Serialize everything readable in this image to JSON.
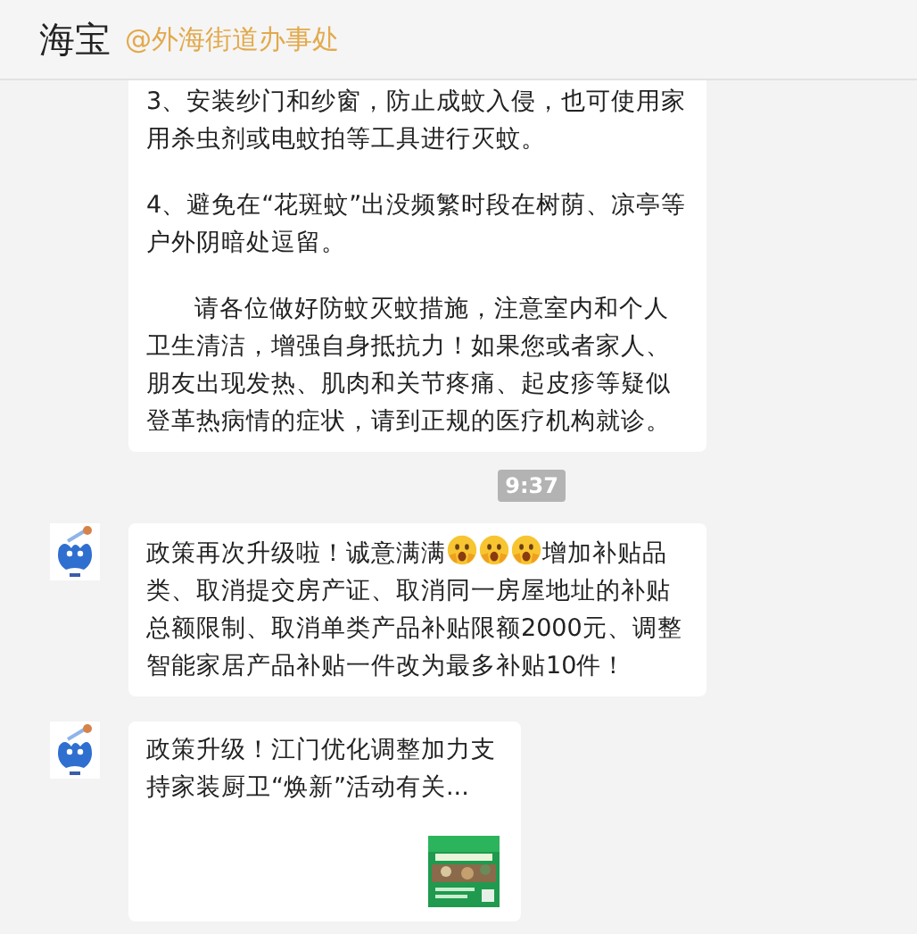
{
  "header": {
    "title": "海宝",
    "subtitle": "@外海街道办事处"
  },
  "messages": [
    {
      "kind": "text",
      "avatar": false,
      "paragraphs": [
        {
          "text": "3、安装纱门和纱窗，防止成蚊入侵，也可使用家用杀虫剂或电蚊拍等工具进行灭蚊。",
          "indent": false
        },
        {
          "text": "4、避免在“花斑蚊”出没频繁时段在树荫、凉亭等户外阴暗处逗留。",
          "indent": false
        },
        {
          "text": "请各位做好防蚊灭蚊措施，注意室内和个人卫生清洁，增强自身抵抗力！如果您或者家人、朋友出现发热、肌肉和关节疼痛、起皮疹等疑似登革热病情的症状，请到正规的医疗机构就诊。",
          "indent": true
        }
      ]
    },
    {
      "kind": "time",
      "text": "9:37"
    },
    {
      "kind": "rich",
      "avatar": true,
      "segments": [
        {
          "kind": "text",
          "text": "政策再次升级啦！诚意满满"
        },
        {
          "kind": "emoji"
        },
        {
          "kind": "emoji"
        },
        {
          "kind": "emoji"
        },
        {
          "kind": "text",
          "text": "增加补贴品类、取消提交房产证、取消同一房屋地址的补贴总额限制、取消单类产品补贴限额2000元、调整智能家居产品补贴一件改为最多补贴10件！"
        }
      ]
    },
    {
      "kind": "link",
      "avatar": true,
      "title": "政策升级！江门优化调整加力支持家装厨卫“焕新”活动有关..."
    }
  ]
}
